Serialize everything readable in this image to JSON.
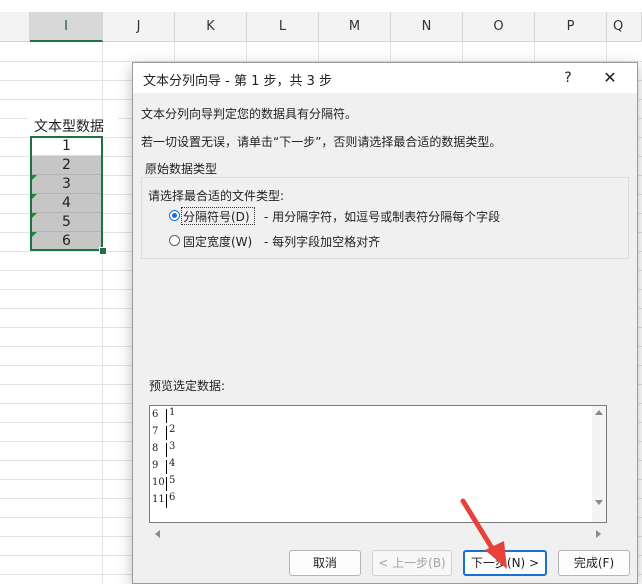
{
  "sheet": {
    "columns": [
      "I",
      "J",
      "K",
      "L",
      "M",
      "N",
      "O",
      "P",
      "Q"
    ],
    "selected_column": "I",
    "header_cell": "文本型数据",
    "values": [
      "1",
      "2",
      "3",
      "4",
      "5",
      "6"
    ]
  },
  "dialog": {
    "title": "文本分列向导 - 第 1 步，共 3 步",
    "help": "?",
    "close": "✕",
    "intro1": "文本分列向导判定您的数据具有分隔符。",
    "intro2": "若一切设置无误，请单击“下一步”，否则请选择最合适的数据类型。",
    "group_label": "原始数据类型",
    "choose_label": "请选择最合适的文件类型:",
    "options": [
      {
        "label": "分隔符号(D)",
        "desc": "- 用分隔字符，如逗号或制表符分隔每个字段",
        "selected": true
      },
      {
        "label": "固定宽度(W)",
        "desc": "- 每列字段加空格对齐",
        "selected": false
      }
    ],
    "preview_label": "预览选定数据:",
    "preview_rows": [
      {
        "num": "6",
        "val": "1"
      },
      {
        "num": "7",
        "val": "2"
      },
      {
        "num": "8",
        "val": "3"
      },
      {
        "num": "9",
        "val": "4"
      },
      {
        "num": "10",
        "val": "5"
      },
      {
        "num": "11",
        "val": "6"
      }
    ],
    "buttons": {
      "cancel": "取消",
      "back": "< 上一步(B)",
      "next": "下一步(N) >",
      "finish": "完成(F)"
    }
  },
  "colors": {
    "accent": "#1a6fd1",
    "sheet_selection": "#1e7145",
    "arrow": "#e8413a"
  }
}
